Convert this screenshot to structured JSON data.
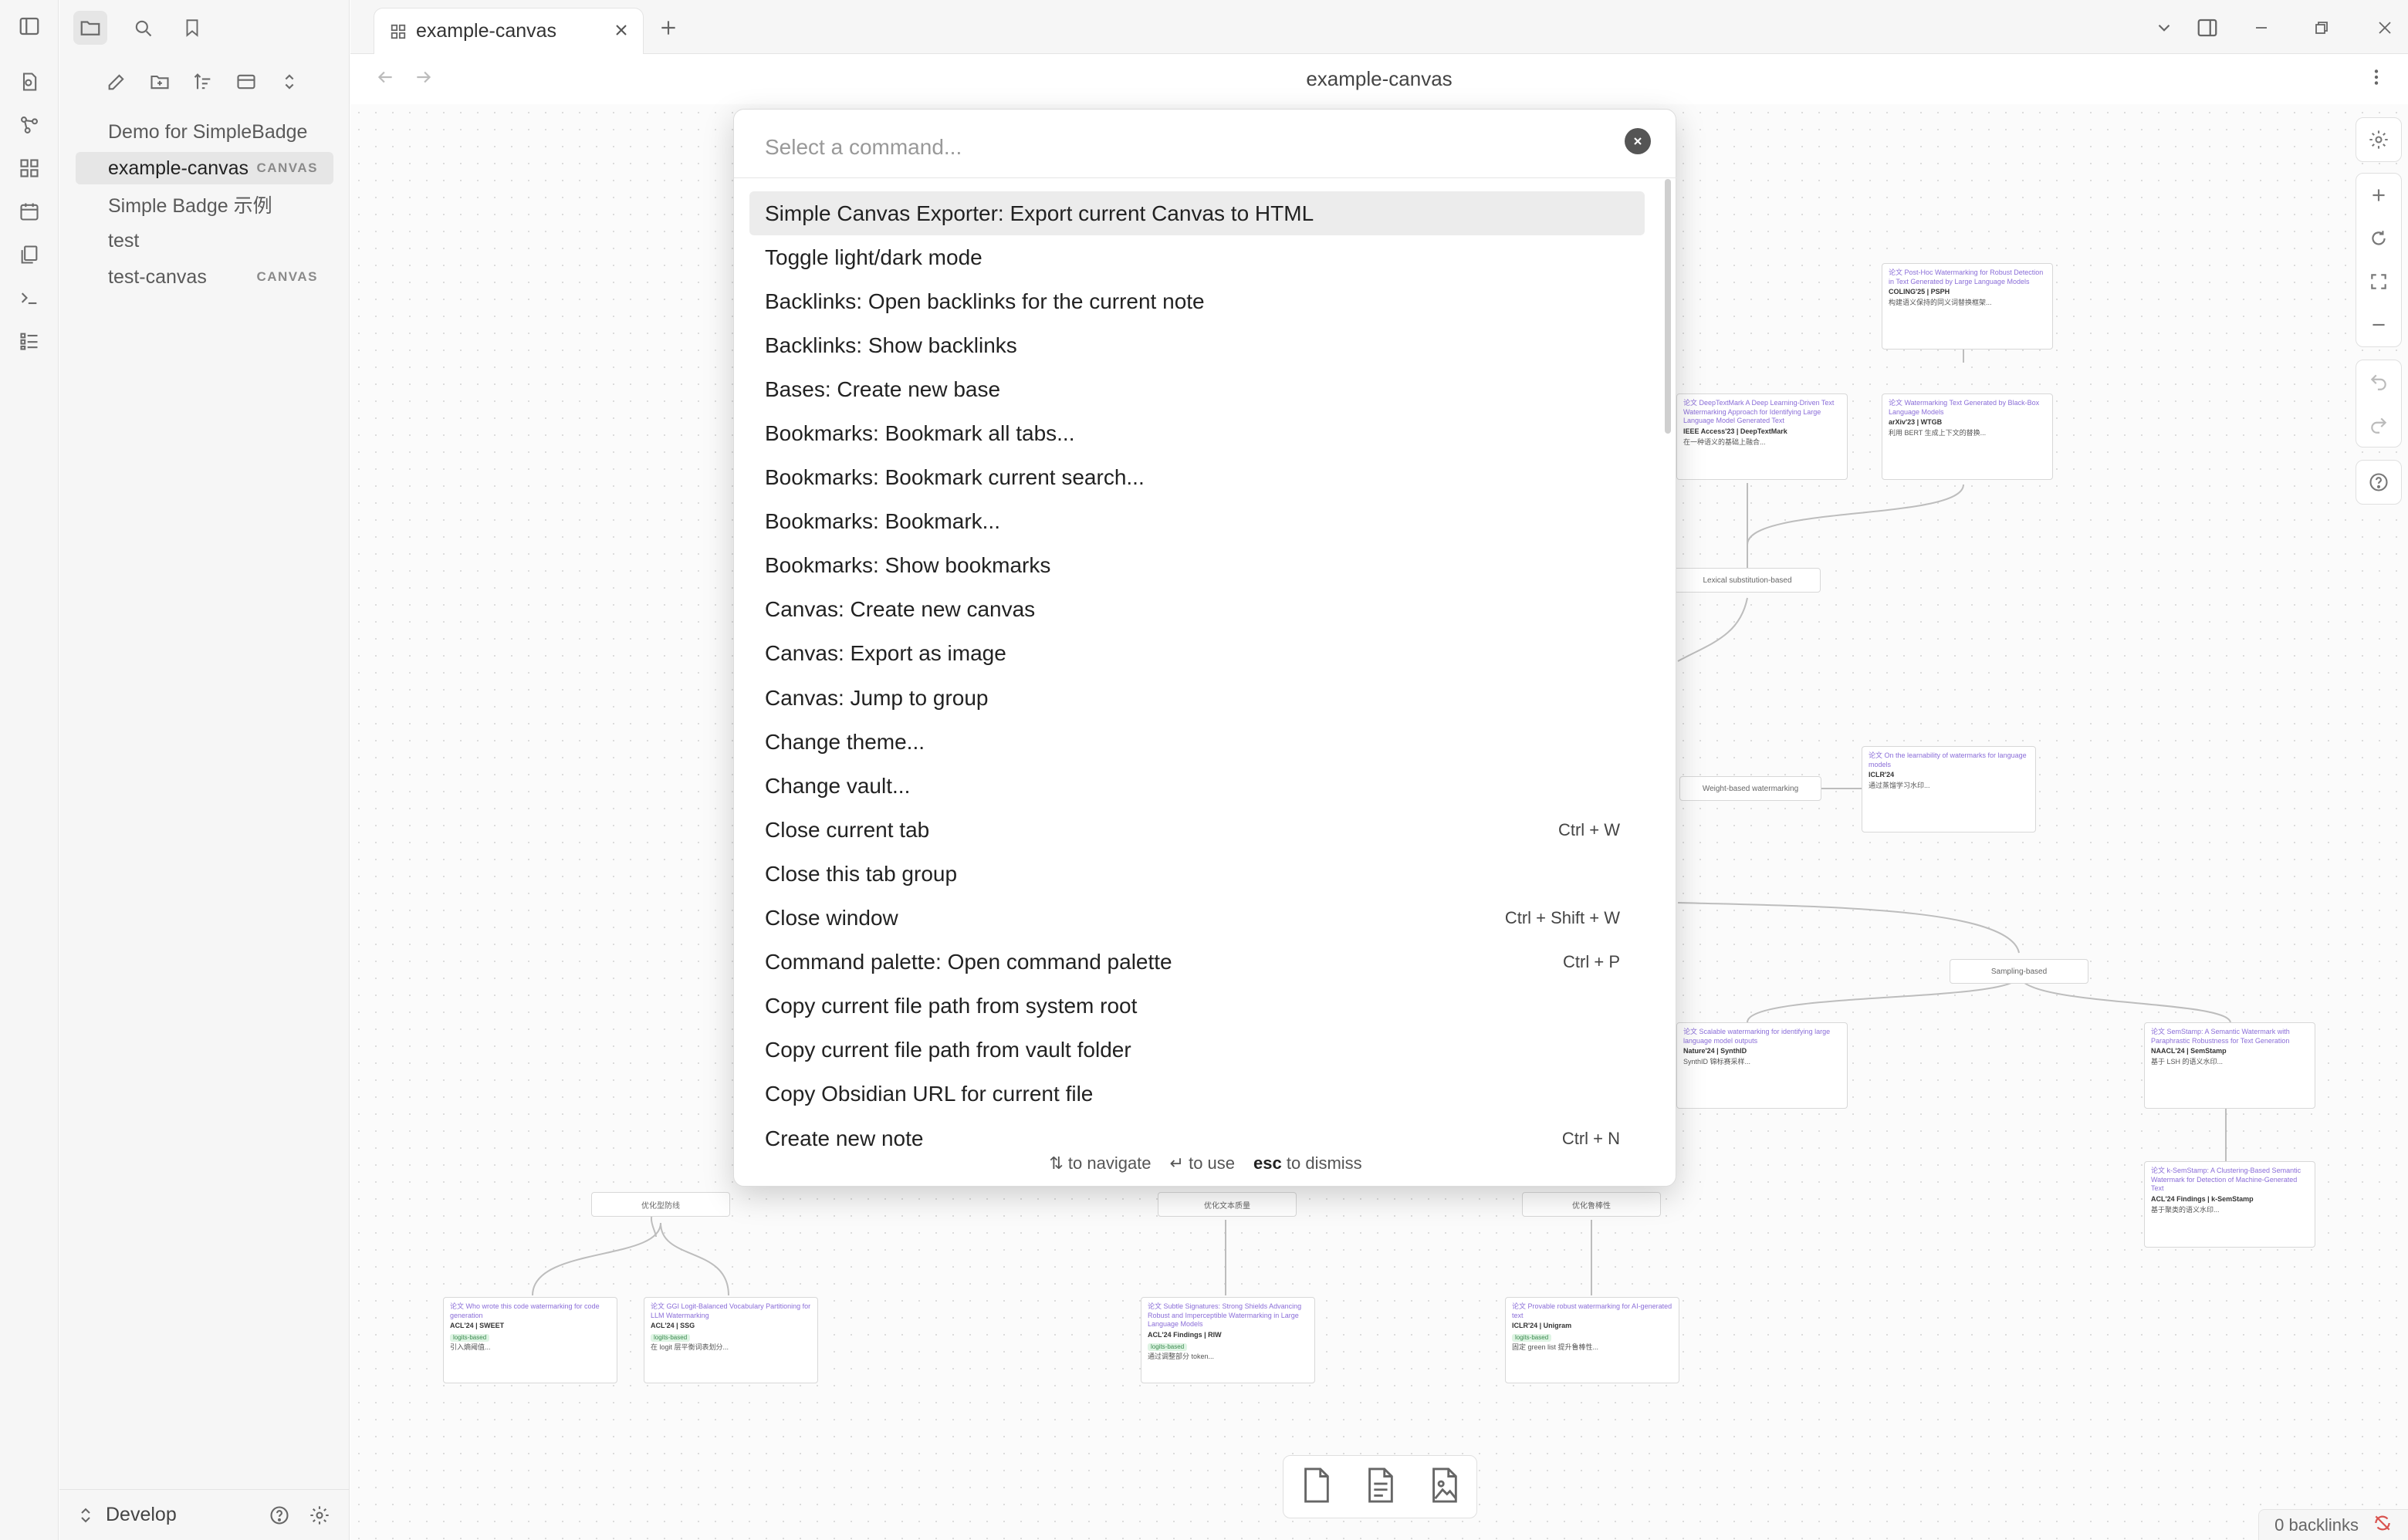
{
  "sidebar": {
    "files": [
      {
        "name": "Demo for SimpleBadge",
        "tag": ""
      },
      {
        "name": "example-canvas",
        "tag": "CANVAS"
      },
      {
        "name": "Simple Badge 示例",
        "tag": ""
      },
      {
        "name": "test",
        "tag": ""
      },
      {
        "name": "test-canvas",
        "tag": "CANVAS"
      }
    ],
    "vault_name": "Develop"
  },
  "tab": {
    "title": "example-canvas"
  },
  "view": {
    "title": "example-canvas"
  },
  "palette": {
    "placeholder": "Select a command...",
    "commands": [
      {
        "label": "Simple Canvas Exporter: Export current Canvas to HTML",
        "hotkey": ""
      },
      {
        "label": "Toggle light/dark mode",
        "hotkey": ""
      },
      {
        "label": "Backlinks: Open backlinks for the current note",
        "hotkey": ""
      },
      {
        "label": "Backlinks: Show backlinks",
        "hotkey": ""
      },
      {
        "label": "Bases: Create new base",
        "hotkey": ""
      },
      {
        "label": "Bookmarks: Bookmark all tabs...",
        "hotkey": ""
      },
      {
        "label": "Bookmarks: Bookmark current search...",
        "hotkey": ""
      },
      {
        "label": "Bookmarks: Bookmark...",
        "hotkey": ""
      },
      {
        "label": "Bookmarks: Show bookmarks",
        "hotkey": ""
      },
      {
        "label": "Canvas: Create new canvas",
        "hotkey": ""
      },
      {
        "label": "Canvas: Export as image",
        "hotkey": ""
      },
      {
        "label": "Canvas: Jump to group",
        "hotkey": ""
      },
      {
        "label": "Change theme...",
        "hotkey": ""
      },
      {
        "label": "Change vault...",
        "hotkey": ""
      },
      {
        "label": "Close current tab",
        "hotkey": "Ctrl + W"
      },
      {
        "label": "Close this tab group",
        "hotkey": ""
      },
      {
        "label": "Close window",
        "hotkey": "Ctrl + Shift + W"
      },
      {
        "label": "Command palette: Open command palette",
        "hotkey": "Ctrl + P"
      },
      {
        "label": "Copy current file path from system root",
        "hotkey": ""
      },
      {
        "label": "Copy current file path from vault folder",
        "hotkey": ""
      },
      {
        "label": "Copy Obsidian URL for current file",
        "hotkey": ""
      },
      {
        "label": "Create new note",
        "hotkey": "Ctrl + N"
      }
    ],
    "footer": {
      "navigate_key": "⇅",
      "navigate_text": "to navigate",
      "use_key": "↵",
      "use_text": "to use",
      "dismiss_key": "esc",
      "dismiss_text": "to dismiss"
    }
  },
  "canvas": {
    "groups": [
      {
        "label": "Lexical substitution-based"
      },
      {
        "label": "Weight-based watermarking"
      },
      {
        "label": "Sampling-based"
      },
      {
        "label": "优化型防线"
      },
      {
        "label": "优化文本质量"
      },
      {
        "label": "优化鲁棒性"
      }
    ],
    "cards": [
      {
        "title": "论文 Post-Hoc Watermarking for Robust Detection in Text Generated by Large Language Models",
        "meta": "COLING'25 | PSPH",
        "tag": "",
        "body": "构建语义保持的同义词替换框架..."
      },
      {
        "title": "论文 DeepTextMark A Deep Learning-Driven Text Watermarking Approach for Identifying Large Language Model Generated Text",
        "meta": "IEEE Access'23 | DeepTextMark",
        "tag": "",
        "body": "在一种语义的基础上融合..."
      },
      {
        "title": "论文 Watermarking Text Generated by Black-Box Language Models",
        "meta": "arXiv'23 | WTGB",
        "tag": "",
        "body": "利用 BERT 生成上下文的替换..."
      },
      {
        "title": "论文 On the learnability of watermarks for language models",
        "meta": "ICLR'24",
        "tag": "",
        "body": "通过蒸馏学习水印..."
      },
      {
        "title": "论文 Scalable watermarking for identifying large language model outputs",
        "meta": "Nature'24 | SynthID",
        "tag": "",
        "body": "SynthID 锦标赛采样..."
      },
      {
        "title": "论文 SemStamp: A Semantic Watermark with Paraphrastic Robustness for Text Generation",
        "meta": "NAACL'24 | SemStamp",
        "tag": "",
        "body": "基于 LSH 的语义水印..."
      },
      {
        "title": "论文 k-SemStamp: A Clustering-Based Semantic Watermark for Detection of Machine-Generated Text",
        "meta": "ACL'24 Findings | k-SemStamp",
        "tag": "",
        "body": "基于聚类的语义水印..."
      },
      {
        "title": "论文 Who wrote this code watermarking for code generation",
        "meta": "ACL'24 | SWEET",
        "tag": "logits-based",
        "body": "引入熵阈值..."
      },
      {
        "title": "论文 GGI Logit-Balanced Vocabulary Partitioning for LLM Watermarking",
        "meta": "ACL'24 | SSG",
        "tag": "logits-based",
        "body": "在 logit 层平衡词表划分..."
      },
      {
        "title": "论文 Subtle Signatures: Strong Shields Advancing Robust and Imperceptible Watermarking in Large Language Models",
        "meta": "ACL'24 Findings | RIW",
        "tag": "logits-based",
        "body": "通过调整部分 token..."
      },
      {
        "title": "论文 Provable robust watermarking for AI-generated text",
        "meta": "ICLR'24 | Unigram",
        "tag": "logits-based",
        "body": "固定 green list 提升鲁棒性..."
      }
    ]
  },
  "status": {
    "backlinks": "0 backlinks"
  },
  "colors": {
    "accent": "#8a6dd8",
    "selection": "#ececec"
  }
}
